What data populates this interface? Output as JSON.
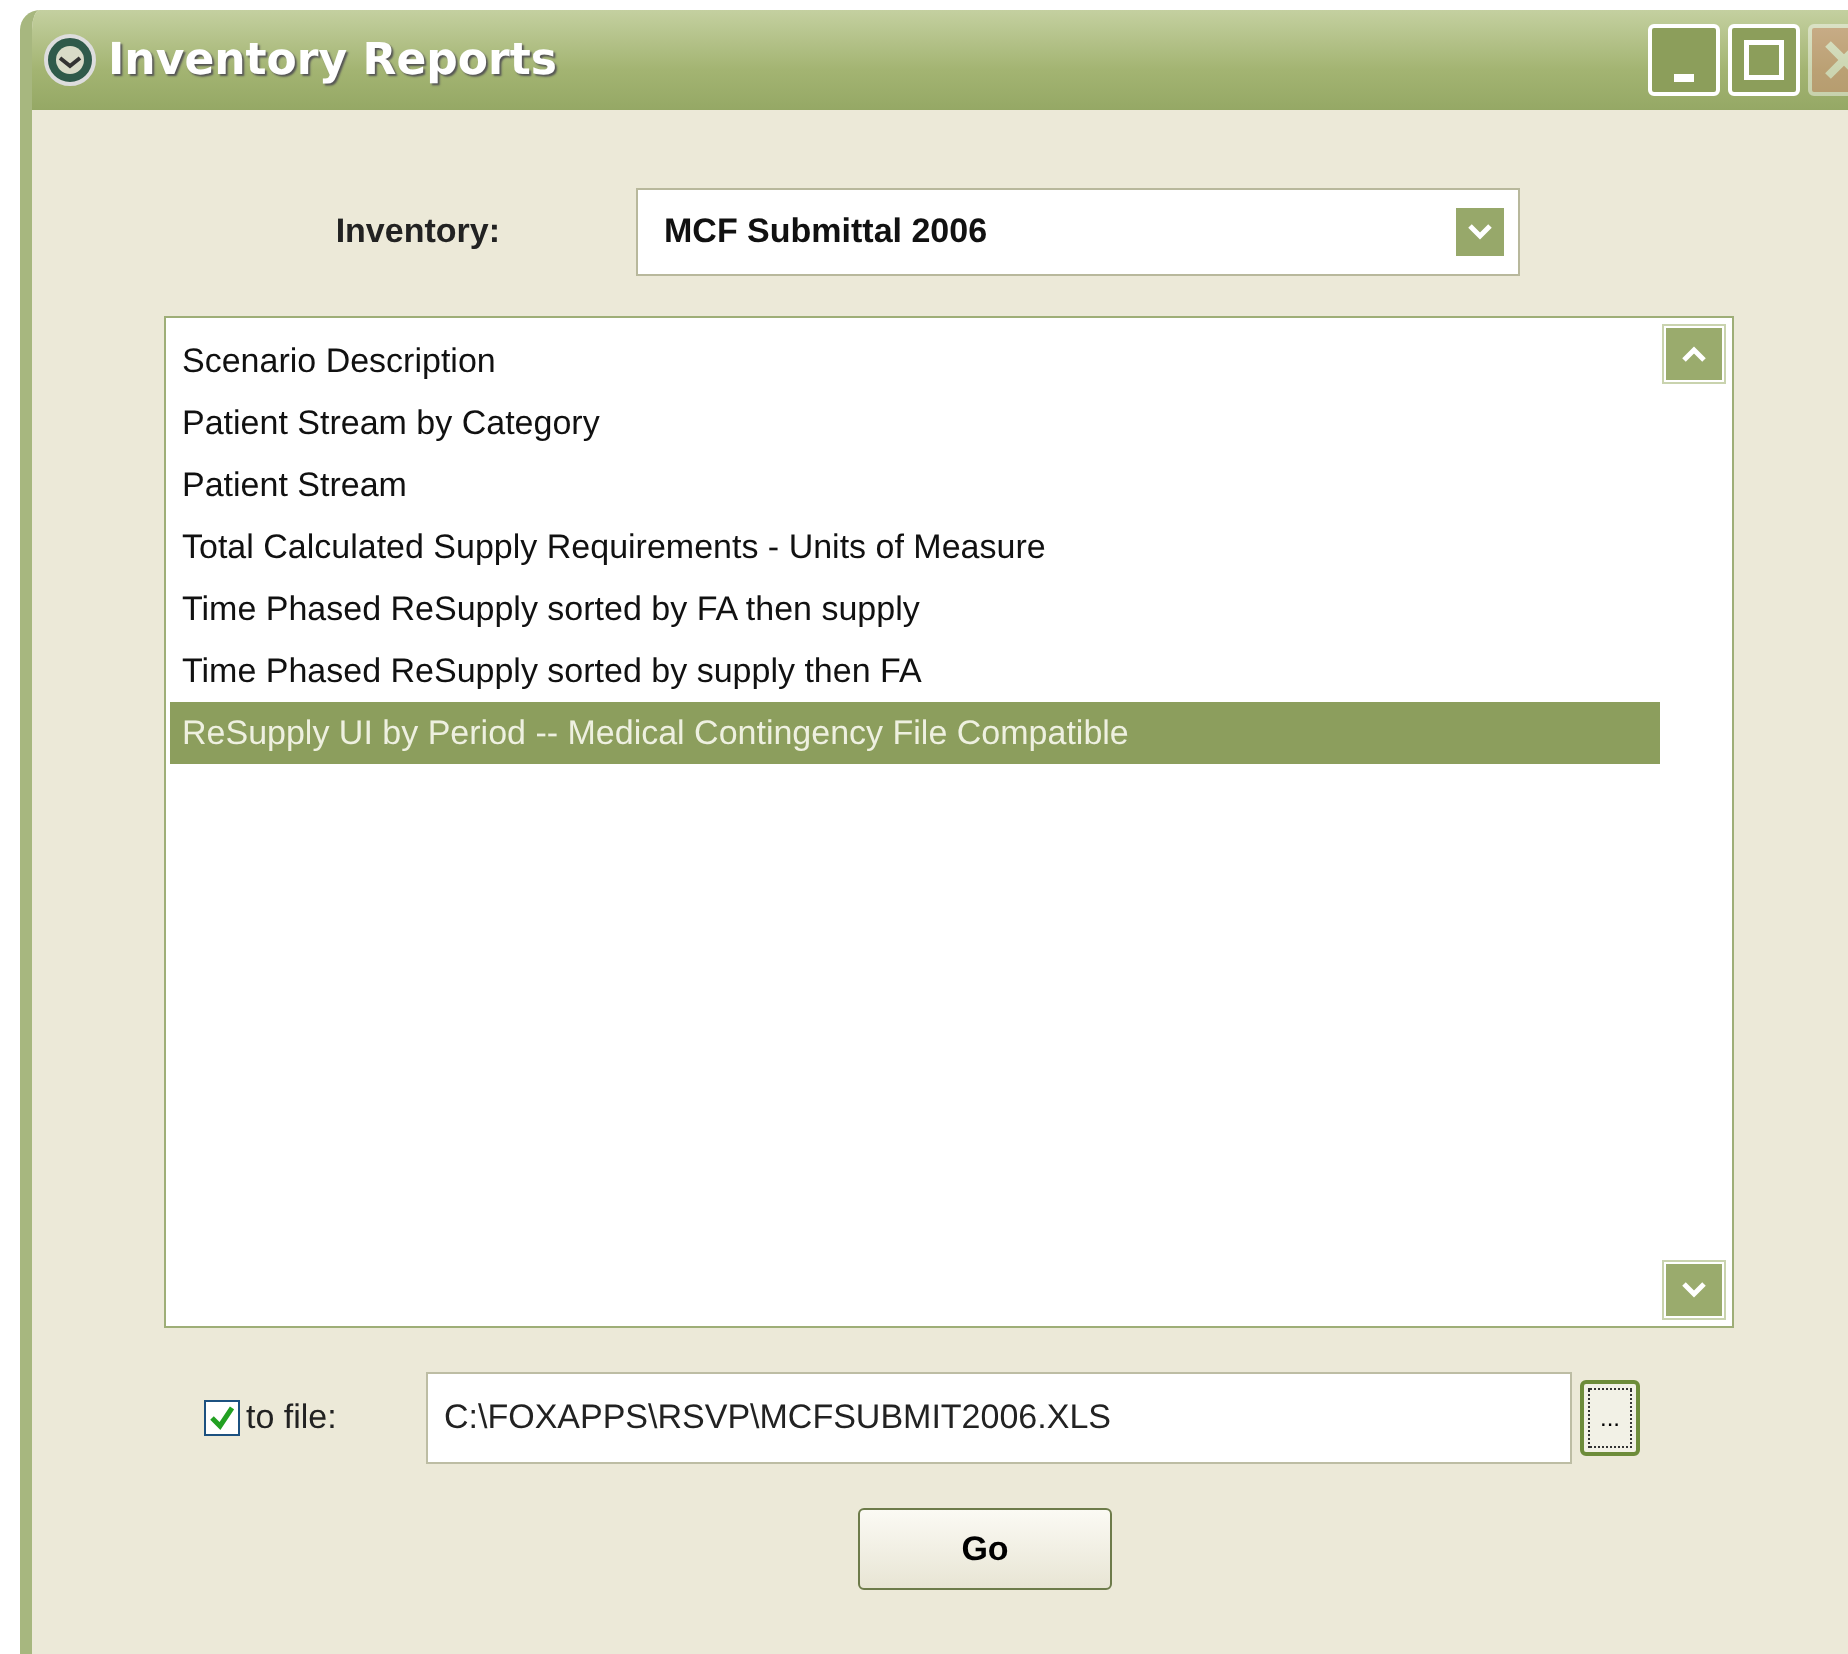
{
  "window": {
    "title": "Inventory Reports",
    "controls": [
      {
        "kind": "minimize",
        "disabled": false
      },
      {
        "kind": "maximize",
        "disabled": false
      },
      {
        "kind": "close",
        "disabled": true
      }
    ]
  },
  "inventory": {
    "label": "Inventory:",
    "value": "MCF Submittal 2006"
  },
  "reports": [
    {
      "label": "Scenario Description",
      "selected": false
    },
    {
      "label": "Patient Stream by Category",
      "selected": false
    },
    {
      "label": "Patient Stream",
      "selected": false
    },
    {
      "label": "Total Calculated Supply Requirements - Units of Measure",
      "selected": false
    },
    {
      "label": "Time Phased ReSupply sorted by FA then supply",
      "selected": false
    },
    {
      "label": "Time Phased ReSupply sorted by supply then FA",
      "selected": false
    },
    {
      "label": "ReSupply UI by Period -- Medical Contingency File Compatible",
      "selected": true
    }
  ],
  "to_file": {
    "label": "to file:",
    "checked": true,
    "value": "C:\\FOXAPPS\\RSVP\\MCFSUBMIT2006.XLS",
    "browse": "..."
  },
  "go_button": "Go"
}
